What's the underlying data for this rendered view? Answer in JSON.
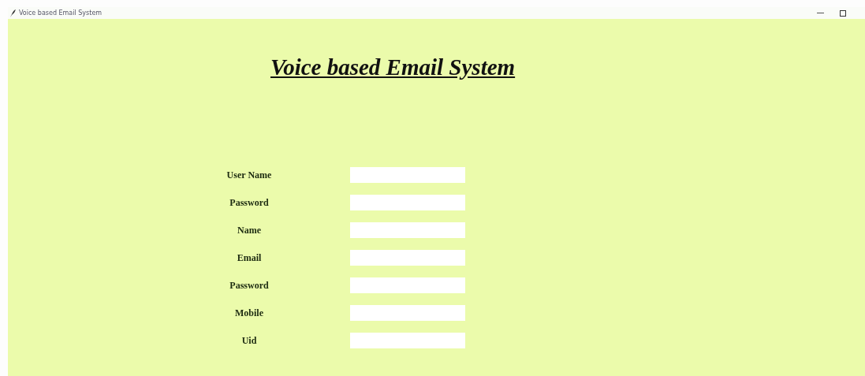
{
  "window": {
    "title": "Voice based Email System"
  },
  "heading": "Voice based Email System",
  "fields": [
    {
      "label": "User Name"
    },
    {
      "label": "Password"
    },
    {
      "label": "Name"
    },
    {
      "label": "Email"
    },
    {
      "label": "Password"
    },
    {
      "label": "Mobile"
    },
    {
      "label": "Uid"
    }
  ]
}
